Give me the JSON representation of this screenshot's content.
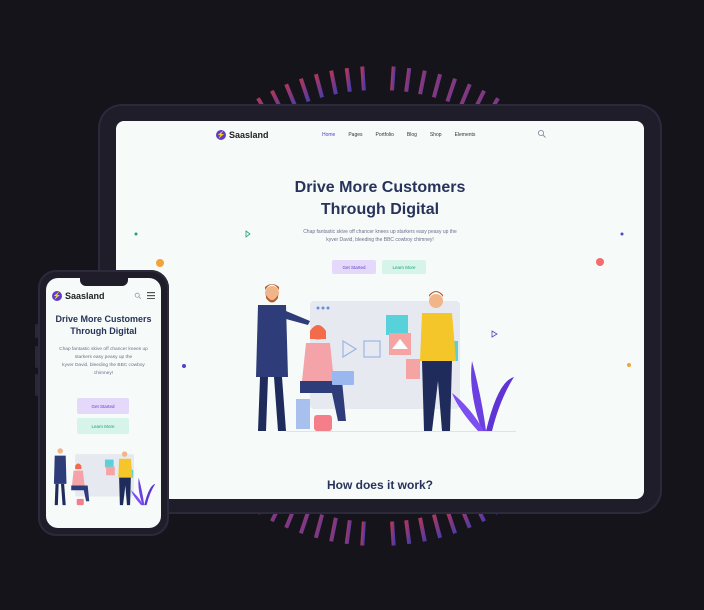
{
  "tablet": {
    "brand": "Saasland",
    "nav_items": [
      "Home",
      "Pages",
      "Portfolio",
      "Blog",
      "Shop",
      "Elements"
    ],
    "active_nav": "Home",
    "hero_title_line1": "Drive More Customers",
    "hero_title_line2": "Through Digital",
    "hero_sub_line1": "Chap fantastic skive off chancer knees up starkers easy peasy up the",
    "hero_sub_line2": "kyver David, bleeding the BBC cowboy chimney!",
    "btn_primary": "Get Started",
    "btn_secondary": "Learn More",
    "section_title": "How does it work?"
  },
  "phone": {
    "brand": "Saasland",
    "hero_title_line1": "Drive More Customers",
    "hero_title_line2": "Through Digital",
    "hero_sub_line1": "Chap fantastic skive off chancer knees up",
    "hero_sub_line2": "starkers easy peasy up the",
    "hero_sub_line3": "kyver David, bleeding the BBC cowboy",
    "hero_sub_line4": "chimney!",
    "btn_primary": "Get Started",
    "btn_secondary": "Learn More"
  },
  "colors": {
    "background": "#14141a",
    "brand": "#5b3ec8",
    "heading": "#27335a",
    "accent_green": "#21a174",
    "ring_start": "#b0365a",
    "ring_end": "#4f3ba8"
  },
  "icons": {
    "search": "search-icon",
    "menu": "hamburger-menu-icon",
    "logo": "saasland-logo-icon"
  }
}
